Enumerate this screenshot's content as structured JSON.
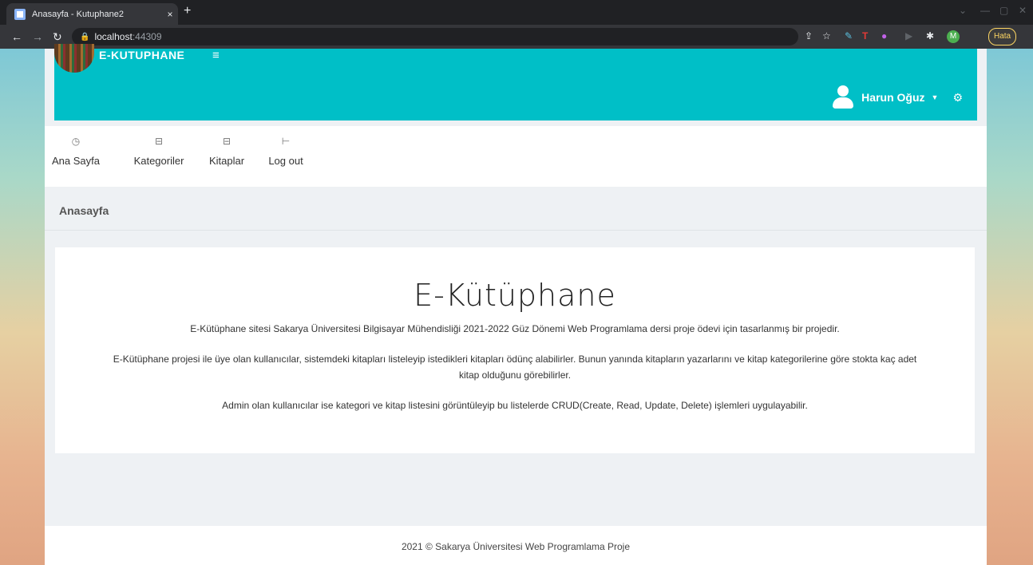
{
  "browser": {
    "tab_title": "Anasayfa - Kutuphane2",
    "tab_close": "×",
    "new_tab": "+",
    "url_host": "localhost",
    "url_port": ":44309",
    "error_badge": "Hata"
  },
  "header": {
    "brand": "E-KUTUPHANE",
    "user_name": "Harun Oğuz",
    "brand_color": "#00bfc7"
  },
  "menu": {
    "items": [
      {
        "label": "Ana Sayfa",
        "icon": "clock-icon"
      },
      {
        "label": "Kategoriler",
        "icon": "inbox-icon"
      },
      {
        "label": "Kitaplar",
        "icon": "inbox-icon"
      },
      {
        "label": "Log out",
        "icon": "logout-icon"
      }
    ]
  },
  "breadcrumb": {
    "title": "Anasayfa"
  },
  "content": {
    "heading": "E-Kütüphane",
    "paragraphs": [
      "E-Kütüphane sitesi Sakarya Üniversitesi Bilgisayar Mühendisliği 2021-2022 Güz Dönemi Web Programlama dersi proje ödevi için tasarlanmış bir projedir.",
      "E-Kütüphane projesi ile üye olan kullanıcılar, sistemdeki kitapları listeleyip istedikleri kitapları ödünç alabilirler. Bunun yanında kitapların yazarlarını ve kitap kategorilerine göre stokta kaç adet kitap olduğunu görebilirler.",
      "Admin olan kullanıcılar ise kategori ve kitap listesini görüntüleyip bu listelerde CRUD(Create, Read, Update, Delete) işlemleri uygulayabilir."
    ]
  },
  "footer": {
    "text": "2021 © Sakarya Üniversitesi Web Programlama Proje"
  }
}
